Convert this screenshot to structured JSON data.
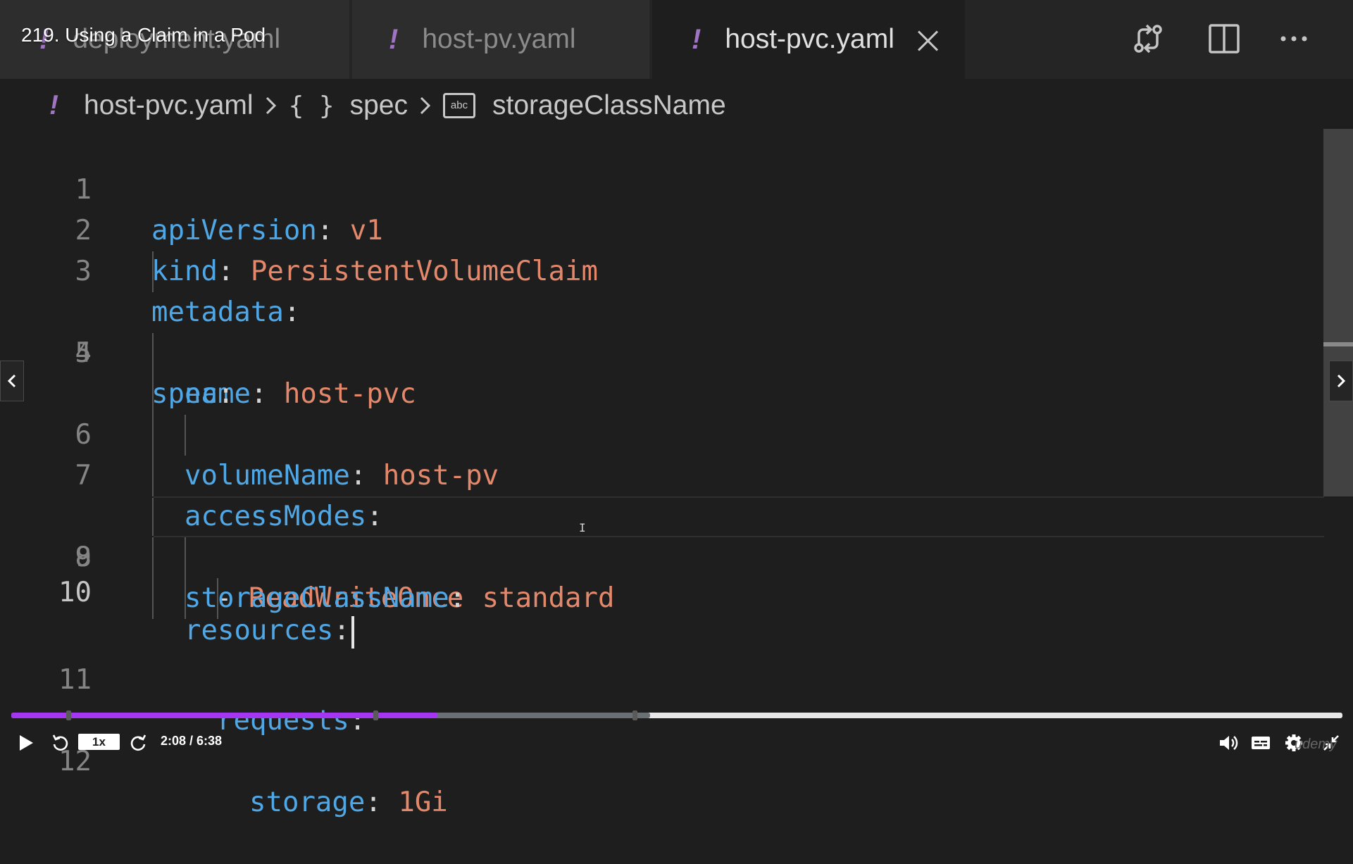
{
  "course": {
    "lecture_title": "219. Using a Claim in a Pod"
  },
  "tabs": [
    {
      "label": "deployment.yaml",
      "active": false,
      "icon": "yaml-exclamation-icon"
    },
    {
      "label": "host-pv.yaml",
      "active": false,
      "icon": "yaml-exclamation-icon"
    },
    {
      "label": "host-pvc.yaml",
      "active": true,
      "icon": "yaml-exclamation-icon"
    }
  ],
  "tab_icons": {
    "close": "close-icon",
    "compare": "open-changes-icon",
    "split": "split-editor-icon",
    "more": "more-actions-icon"
  },
  "breadcrumb": {
    "file": "host-pvc.yaml",
    "object_icon": "{ }",
    "object": "spec",
    "field_icon": "abc",
    "field": "storageClassName"
  },
  "code": {
    "lines": [
      {
        "num": "1",
        "key": "apiVersion",
        "sep": ": ",
        "value": "v1"
      },
      {
        "num": "2",
        "key": "kind",
        "sep": ": ",
        "value": "PersistentVolumeClaim"
      },
      {
        "num": "3",
        "key": "metadata",
        "sep": ":",
        "value": ""
      },
      {
        "num": "4",
        "key": "name",
        "sep": ": ",
        "value": "host-pvc"
      },
      {
        "num": "5",
        "key": "spec",
        "sep": ":",
        "value": ""
      },
      {
        "num": "6",
        "key": "volumeName",
        "sep": ": ",
        "value": "host-pv"
      },
      {
        "num": "7",
        "key": "accessModes",
        "sep": ":",
        "value": ""
      },
      {
        "num": "8",
        "key": "- ",
        "sep": "",
        "value": "ReadWriteOnce"
      },
      {
        "num": "9",
        "key": "storageClassName",
        "sep": ": ",
        "value": "standard"
      },
      {
        "num": "10",
        "key": "resources",
        "sep": ":",
        "value": ""
      },
      {
        "num": "11",
        "key": "requests",
        "sep": ":",
        "value": ""
      },
      {
        "num": "12",
        "key": "storage",
        "sep": ": ",
        "value": "1Gi"
      }
    ]
  },
  "player": {
    "speed": "1x",
    "time": "2:08 / 6:38",
    "progress_fraction": 0.32,
    "buffered_fraction": 0.48,
    "icons": [
      "play-icon",
      "rewind-icon",
      "forward-icon",
      "volume-icon",
      "captions-icon",
      "settings-icon",
      "fullscreen-exit-icon"
    ],
    "watermark": "udemy"
  },
  "colors": {
    "accent": "#a435f0",
    "yaml_key": "#4fa7e6",
    "yaml_value": "#e4886b",
    "yaml_icon": "#a074c4"
  }
}
